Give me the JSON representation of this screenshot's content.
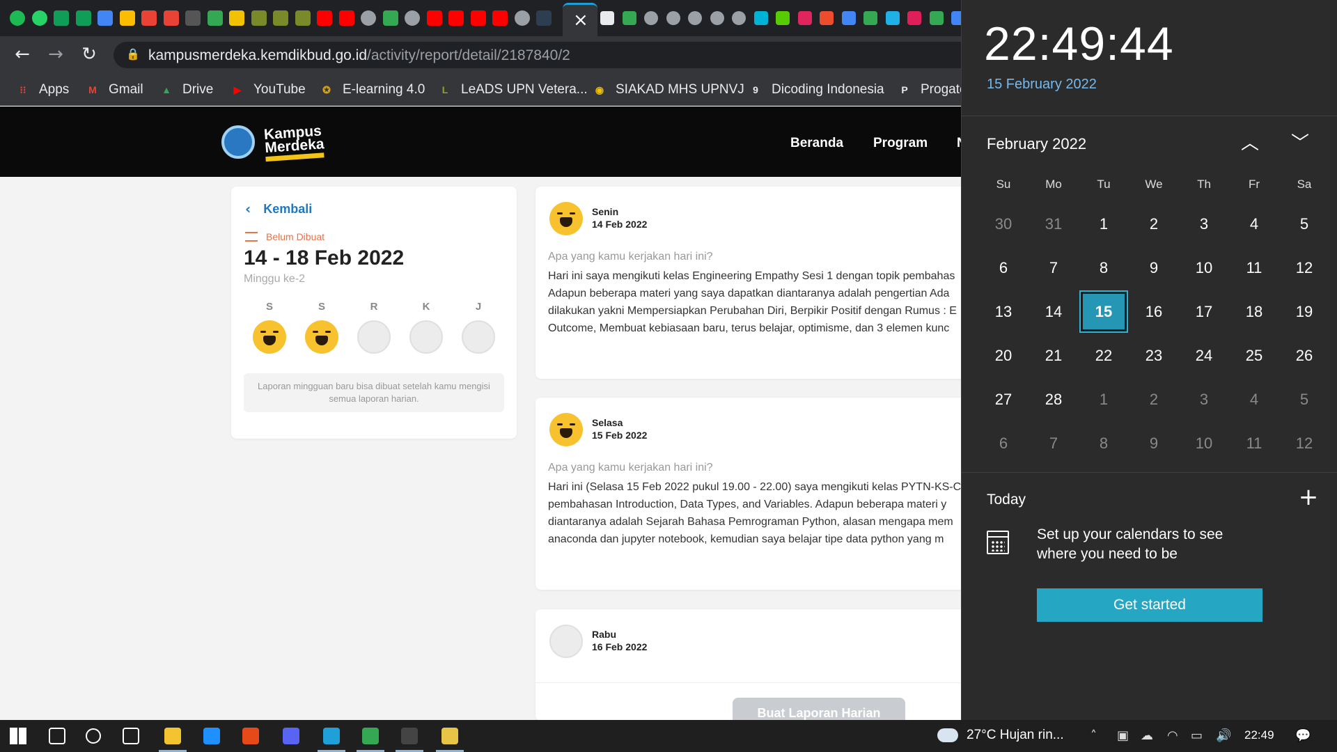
{
  "browser": {
    "tab_icons": [
      {
        "name": "spotify-icon",
        "color": "#1db954",
        "round": true
      },
      {
        "name": "whatsapp-icon",
        "color": "#25d366",
        "round": true
      },
      {
        "name": "sheets-icon",
        "color": "#0f9d58"
      },
      {
        "name": "sheets-icon",
        "color": "#0f9d58"
      },
      {
        "name": "calendar-icon",
        "color": "#4285f4"
      },
      {
        "name": "keep-icon",
        "color": "#fbbc04"
      },
      {
        "name": "gmail-icon",
        "color": "#ea4335"
      },
      {
        "name": "gmail-icon",
        "color": "#ea4335"
      },
      {
        "name": "game-icon",
        "color": "#555555"
      },
      {
        "name": "drive-icon",
        "color": "#34a853"
      },
      {
        "name": "upnvj-icon",
        "color": "#f2c200"
      },
      {
        "name": "leads-icon",
        "color": "#7a8a2a"
      },
      {
        "name": "leads-icon",
        "color": "#7a8a2a"
      },
      {
        "name": "leads-icon",
        "color": "#7a8a2a"
      },
      {
        "name": "youtube-icon",
        "color": "#ff0000"
      },
      {
        "name": "youtube-icon",
        "color": "#ff0000"
      },
      {
        "name": "globe-icon",
        "color": "#9aa0a6",
        "round": true
      },
      {
        "name": "drive-icon",
        "color": "#34a853"
      },
      {
        "name": "globe-icon",
        "color": "#9aa0a6",
        "round": true
      },
      {
        "name": "youtube-icon",
        "color": "#ff0000"
      },
      {
        "name": "youtube-icon",
        "color": "#ff0000"
      },
      {
        "name": "youtube-icon",
        "color": "#ff0000"
      },
      {
        "name": "youtube-icon",
        "color": "#ff0000"
      },
      {
        "name": "globe-icon",
        "color": "#9aa0a6",
        "round": true
      },
      {
        "name": "dicoding-icon",
        "color": "#2d3e50"
      }
    ],
    "tab_icons_right": [
      {
        "name": "compass-icon",
        "color": "#e8eaed"
      },
      {
        "name": "drive-icon",
        "color": "#34a853"
      },
      {
        "name": "globe-icon",
        "color": "#9aa0a6",
        "round": true
      },
      {
        "name": "globe-icon",
        "color": "#9aa0a6",
        "round": true
      },
      {
        "name": "globe-icon",
        "color": "#9aa0a6",
        "round": true
      },
      {
        "name": "globe-icon",
        "color": "#9aa0a6",
        "round": true
      },
      {
        "name": "globe-icon",
        "color": "#9aa0a6",
        "round": true
      },
      {
        "name": "ok-icon",
        "color": "#00b2d6"
      },
      {
        "name": "owl-icon",
        "color": "#58cc02"
      },
      {
        "name": "b-icon",
        "color": "#e0245e"
      },
      {
        "name": "shop-icon",
        "color": "#ee4d2d"
      },
      {
        "name": "translate-icon",
        "color": "#4285f4"
      },
      {
        "name": "drive-icon",
        "color": "#34a853"
      },
      {
        "name": "k-icon",
        "color": "#1fb1e6"
      },
      {
        "name": "slack-icon",
        "color": "#e01e5a"
      },
      {
        "name": "drive-icon",
        "color": "#34a853"
      },
      {
        "name": "docs-icon",
        "color": "#4285f4"
      }
    ],
    "url_host": "kampusmerdeka.kemdikbud.go.id",
    "url_path": "/activity/report/detail/2187840/2",
    "bookmarks": [
      {
        "label": "Apps",
        "icon": "apps-icon",
        "color": "#e8453c",
        "glyph": "⁝⁝"
      },
      {
        "label": "Gmail",
        "icon": "gmail-icon",
        "color": "#ea4335",
        "glyph": "M"
      },
      {
        "label": "Drive",
        "icon": "drive-icon",
        "color": "#34a853",
        "glyph": "▲"
      },
      {
        "label": "YouTube",
        "icon": "youtube-icon",
        "color": "#ff0000",
        "glyph": "▶"
      },
      {
        "label": "E-learning 4.0",
        "icon": "upnvj-icon",
        "color": "#d4a017",
        "glyph": "✪"
      },
      {
        "label": "LeADS UPN Vetera...",
        "icon": "leads-icon",
        "color": "#8aa52c",
        "glyph": "L"
      },
      {
        "label": "SIAKAD MHS UPNVJ",
        "icon": "siakad-icon",
        "color": "#f2c200",
        "glyph": "◉"
      },
      {
        "label": "Dicoding Indonesia",
        "icon": "dicoding-icon",
        "color": "#e8eaed",
        "glyph": "9"
      },
      {
        "label": "Progate",
        "icon": "progate-icon",
        "color": "#e8eaed",
        "glyph": "P"
      }
    ]
  },
  "header": {
    "logo_text": "Kampus Merdeka",
    "nav": [
      "Beranda",
      "Program",
      "N"
    ]
  },
  "week_card": {
    "back_label": "Kembali",
    "status": "Belum Dibuat",
    "title": "14 - 18 Feb 2022",
    "subtitle": "Minggu ke-2",
    "days": [
      {
        "label": "S",
        "filled": true
      },
      {
        "label": "S",
        "filled": true
      },
      {
        "label": "R",
        "filled": false
      },
      {
        "label": "K",
        "filled": false
      },
      {
        "label": "J",
        "filled": false
      }
    ],
    "info": "Laporan mingguan baru bisa dibuat setelah kamu mengisi semua laporan harian."
  },
  "reports": [
    {
      "day": "Senin",
      "date": "14 Feb 2022",
      "question": "Apa yang kamu kerjakan hari ini?",
      "lines": [
        "Hari ini saya mengikuti kelas Engineering Empathy Sesi 1 dengan topik pembahas",
        "Adapun beberapa materi yang saya dapatkan diantaranya adalah pengertian Ada",
        "dilakukan yakni Mempersiapkan Perubahan Diri, Berpikir Positif dengan Rumus : E",
        "Outcome, Membuat kebiasaan baru, terus belajar, optimisme, dan 3 elemen kunc"
      ]
    },
    {
      "day": "Selasa",
      "date": "15 Feb 2022",
      "question": "Apa yang kamu kerjakan hari ini?",
      "lines": [
        "Hari ini (Selasa 15 Feb 2022 pukul 19.00 - 22.00) saya mengikuti kelas PYTN-KS-C",
        "pembahasan Introduction, Data Types, and Variables. Adapun beberapa materi y",
        "diantaranya adalah Sejarah Bahasa Pemrograman Python, alasan mengapa mem",
        "anaconda dan jupyter notebook, kemudian saya belajar tipe data python yang m"
      ]
    },
    {
      "day": "Rabu",
      "date": "16 Feb 2022"
    }
  ],
  "create_button": "Buat Laporan Harian",
  "calendar": {
    "time": "22:49:44",
    "date_long": "15 February 2022",
    "month_title": "February 2022",
    "weekdays": [
      "Su",
      "Mo",
      "Tu",
      "We",
      "Th",
      "Fr",
      "Sa"
    ],
    "weeks": [
      [
        {
          "d": "30",
          "m": true
        },
        {
          "d": "31",
          "m": true
        },
        {
          "d": "1"
        },
        {
          "d": "2"
        },
        {
          "d": "3"
        },
        {
          "d": "4"
        },
        {
          "d": "5"
        }
      ],
      [
        {
          "d": "6"
        },
        {
          "d": "7"
        },
        {
          "d": "8"
        },
        {
          "d": "9"
        },
        {
          "d": "10"
        },
        {
          "d": "11"
        },
        {
          "d": "12"
        }
      ],
      [
        {
          "d": "13"
        },
        {
          "d": "14"
        },
        {
          "d": "15",
          "t": true
        },
        {
          "d": "16"
        },
        {
          "d": "17"
        },
        {
          "d": "18"
        },
        {
          "d": "19"
        }
      ],
      [
        {
          "d": "20"
        },
        {
          "d": "21"
        },
        {
          "d": "22"
        },
        {
          "d": "23"
        },
        {
          "d": "24"
        },
        {
          "d": "25"
        },
        {
          "d": "26"
        }
      ],
      [
        {
          "d": "27"
        },
        {
          "d": "28"
        },
        {
          "d": "1",
          "m": true
        },
        {
          "d": "2",
          "m": true
        },
        {
          "d": "3",
          "m": true
        },
        {
          "d": "4",
          "m": true
        },
        {
          "d": "5",
          "m": true
        }
      ],
      [
        {
          "d": "6",
          "m": true
        },
        {
          "d": "7",
          "m": true
        },
        {
          "d": "8",
          "m": true
        },
        {
          "d": "9",
          "m": true
        },
        {
          "d": "10",
          "m": true
        },
        {
          "d": "11",
          "m": true
        },
        {
          "d": "12",
          "m": true
        }
      ]
    ],
    "today_label": "Today",
    "setup_text": "Set up your calendars to see where you need to be",
    "get_started": "Get started",
    "accent": "#2597b4"
  },
  "taskbar": {
    "apps": [
      {
        "name": "start-button",
        "color": "#ffffff",
        "running": false
      },
      {
        "name": "search-icon",
        "color": "#ffffff",
        "running": false
      },
      {
        "name": "cortana-icon",
        "color": "#ffffff",
        "running": false
      },
      {
        "name": "task-view-icon",
        "color": "#ffffff",
        "running": false
      },
      {
        "name": "file-explorer-icon",
        "color": "#f4c430",
        "running": true
      },
      {
        "name": "mail-icon",
        "color": "#1e90ff",
        "running": false
      },
      {
        "name": "office-icon",
        "color": "#e64a19",
        "running": false
      },
      {
        "name": "discord-icon",
        "color": "#5865f2",
        "running": false
      },
      {
        "name": "edge-icon",
        "color": "#1fa0d8",
        "running": true
      },
      {
        "name": "chrome-icon",
        "color": "#34a853",
        "running": true
      },
      {
        "name": "terminal-icon",
        "color": "#444444",
        "running": true
      },
      {
        "name": "git-icon",
        "color": "#e8c547",
        "running": true
      }
    ],
    "weather": "27°C  Hujan rin...",
    "time": "22:49"
  }
}
